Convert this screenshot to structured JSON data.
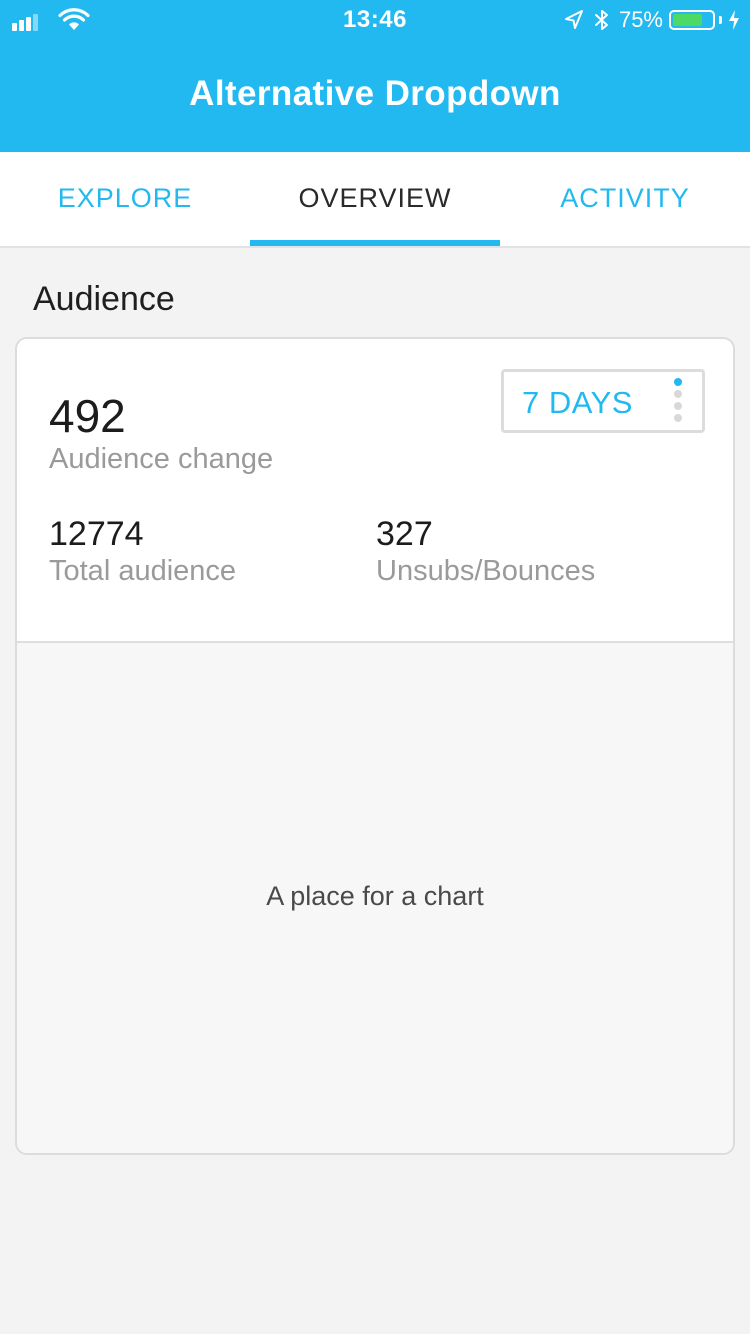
{
  "status_bar": {
    "time": "13:46",
    "battery_percent": "75%",
    "battery_level": 0.75,
    "signal_bars_active": 3,
    "signal_bars_total": 4,
    "icons": [
      "signal-icon",
      "wifi-icon",
      "location-arrow-icon",
      "bluetooth-icon",
      "battery-icon",
      "charging-bolt-icon"
    ]
  },
  "header": {
    "title": "Alternative Dropdown",
    "background_color": "#22b8f0"
  },
  "tabs": [
    {
      "label": "EXPLORE",
      "active": false
    },
    {
      "label": "OVERVIEW",
      "active": true
    },
    {
      "label": "ACTIVITY",
      "active": false
    }
  ],
  "section": {
    "title": "Audience"
  },
  "card": {
    "main_stat": {
      "value": "492",
      "label": "Audience change"
    },
    "period_select": {
      "selected": "7 DAYS",
      "option_count": 4,
      "selected_index": 0
    },
    "sub_stats": [
      {
        "value": "12774",
        "label": "Total audience"
      },
      {
        "value": "327",
        "label": "Unsubs/Bounces"
      }
    ],
    "chart_placeholder": "A place for a chart"
  },
  "colors": {
    "accent": "#22b8f0",
    "battery_fill": "#4cd964",
    "muted_text": "#9a9a9a"
  }
}
